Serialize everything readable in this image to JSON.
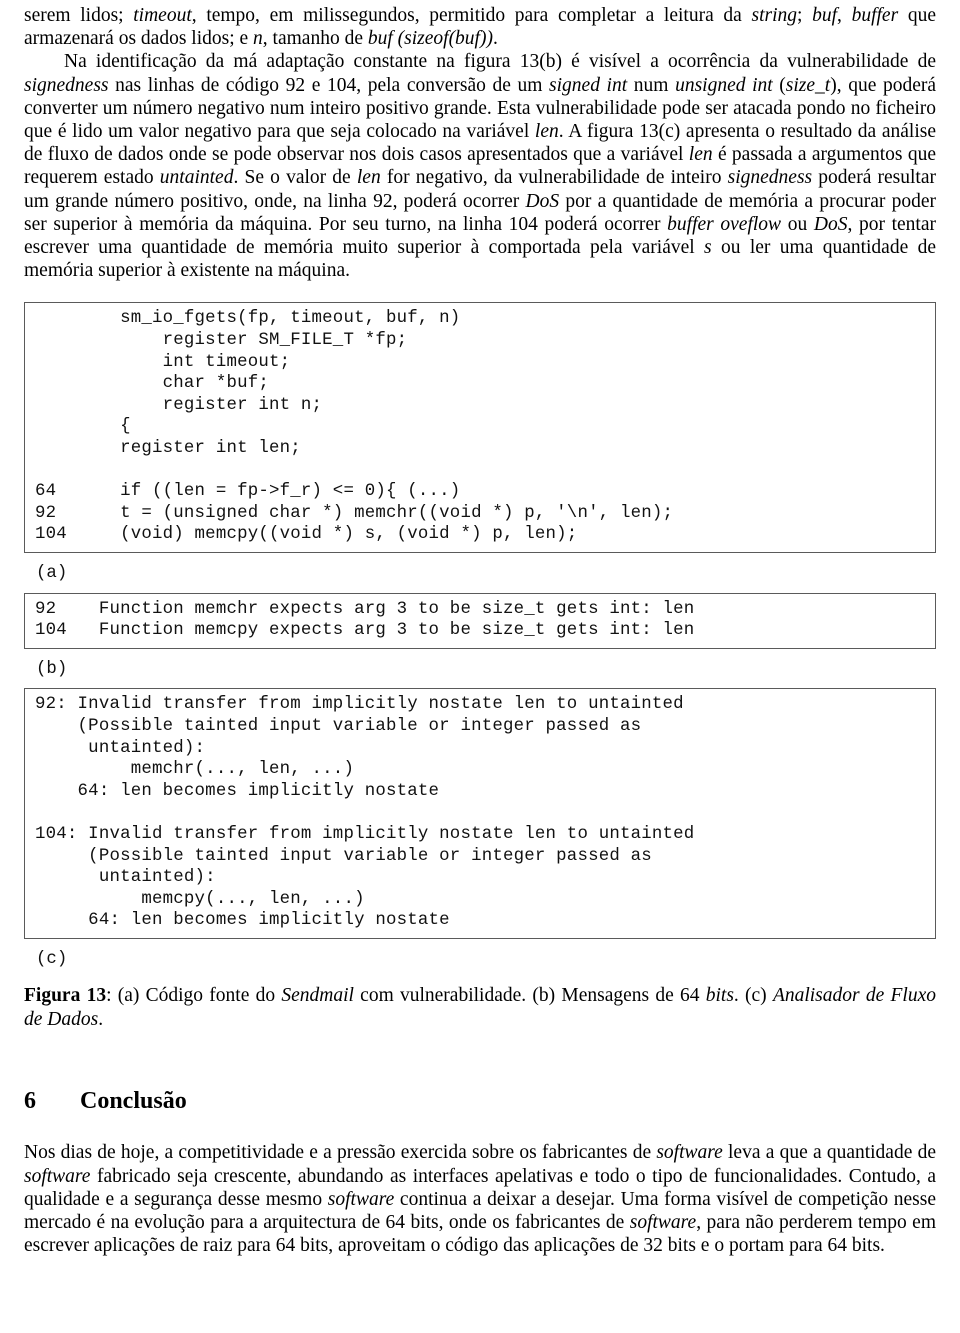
{
  "document": {
    "language": "pt-PT",
    "paragraphs": [
      {
        "id": "para-1",
        "runs": [
          {
            "t": "serem lidos; ",
            "s": "r"
          },
          {
            "t": "timeout",
            "s": "i"
          },
          {
            "t": ", tempo, em milissegundos, permitido para completar a leitura da ",
            "s": "r"
          },
          {
            "t": "string",
            "s": "i"
          },
          {
            "t": "; ",
            "s": "r"
          },
          {
            "t": "buf",
            "s": "i"
          },
          {
            "t": ", ",
            "s": "r"
          },
          {
            "t": "buffer",
            "s": "i"
          },
          {
            "t": " que armazenará os dados lidos; e ",
            "s": "r"
          },
          {
            "t": "n",
            "s": "i"
          },
          {
            "t": ", tamanho de ",
            "s": "r"
          },
          {
            "t": "buf (sizeof(buf))",
            "s": "i"
          },
          {
            "t": ".",
            "s": "r"
          }
        ]
      },
      {
        "id": "para-2",
        "indent": true,
        "runs": [
          {
            "t": "Na identificação da má adaptação constante na figura 13(b) é visível a ocorrência da vulnerabilidade de ",
            "s": "r"
          },
          {
            "t": "signedness",
            "s": "i"
          },
          {
            "t": " nas linhas de código 92 e 104, pela conversão de um ",
            "s": "r"
          },
          {
            "t": "signed int",
            "s": "i"
          },
          {
            "t": " num ",
            "s": "r"
          },
          {
            "t": "unsigned int",
            "s": "i"
          },
          {
            "t": " (",
            "s": "r"
          },
          {
            "t": "size_t",
            "s": "i"
          },
          {
            "t": "), que poderá converter um número negativo num inteiro positivo grande. Esta vulnerabilidade pode ser atacada pondo no ficheiro que é lido um valor negativo para que seja colocado na variável ",
            "s": "r"
          },
          {
            "t": "len",
            "s": "i"
          },
          {
            "t": ". A figura 13(c) apresenta o resultado da análise de fluxo de dados onde se pode observar nos dois casos apresentados que a variável ",
            "s": "r"
          },
          {
            "t": "len",
            "s": "i"
          },
          {
            "t": " é passada a argumentos que requerem estado ",
            "s": "r"
          },
          {
            "t": "untainted",
            "s": "i"
          },
          {
            "t": ". Se o valor de ",
            "s": "r"
          },
          {
            "t": "len",
            "s": "i"
          },
          {
            "t": " for negativo, da vulnerabilidade de inteiro ",
            "s": "r"
          },
          {
            "t": "signedness",
            "s": "i"
          },
          {
            "t": " poderá resultar um grande número positivo, onde, na linha 92, poderá ocorrer ",
            "s": "r"
          },
          {
            "t": "DoS",
            "s": "i"
          },
          {
            "t": " por a quantidade de memória a procurar poder ser superior à memória da máquina. Por seu turno, na linha 104 poderá ocorrer ",
            "s": "r"
          },
          {
            "t": "buffer oveflow",
            "s": "i"
          },
          {
            "t": " ou ",
            "s": "r"
          },
          {
            "t": "DoS",
            "s": "i"
          },
          {
            "t": ", por tentar escrever uma quantidade de memória muito superior à comportada pela variável ",
            "s": "r"
          },
          {
            "t": "s",
            "s": "i"
          },
          {
            "t": " ou ler uma quantidade de memória superior à existente na máquina.",
            "s": "r"
          }
        ]
      }
    ]
  },
  "figure": {
    "id": "figura-13",
    "blocks": {
      "a": {
        "label": "(a)",
        "code": "        sm_io_fgets(fp, timeout, buf, n)\n            register SM_FILE_T *fp;\n            int timeout;\n            char *buf;\n            register int n;\n        {\n        register int len;\n\n64      if ((len = fp->f_r) <= 0){ (...)\n92      t = (unsigned char *) memchr((void *) p, '\\n', len);\n104     (void) memcpy((void *) s, (void *) p, len);"
      },
      "b": {
        "label": "(b)",
        "code": "92    Function memchr expects arg 3 to be size_t gets int: len\n104   Function memcpy expects arg 3 to be size_t gets int: len"
      },
      "c": {
        "label": "(c)",
        "code": "92: Invalid transfer from implicitly nostate len to untainted\n    (Possible tainted input variable or integer passed as\n     untainted):\n         memchr(..., len, ...)\n    64: len becomes implicitly nostate\n\n104: Invalid transfer from implicitly nostate len to untainted\n     (Possible tainted input variable or integer passed as\n      untainted):\n          memcpy(..., len, ...)\n     64: len becomes implicitly nostate"
      }
    },
    "caption_runs": [
      {
        "t": "Figura 13",
        "s": "b"
      },
      {
        "t": ": (a) Código fonte do ",
        "s": "r"
      },
      {
        "t": "Sendmail",
        "s": "i"
      },
      {
        "t": " com vulnerabilidade. (b) Mensagens de 64 ",
        "s": "r"
      },
      {
        "t": "bits",
        "s": "i"
      },
      {
        "t": ". (c) ",
        "s": "r"
      },
      {
        "t": "Analisador de Fluxo de Dados",
        "s": "i"
      },
      {
        "t": ".",
        "s": "r"
      }
    ]
  },
  "section": {
    "number": "6",
    "title": "Conclusão",
    "paragraphs": [
      {
        "id": "concl-p1",
        "runs": [
          {
            "t": "Nos dias de hoje, a competitividade e a pressão exercida sobre os fabricantes de ",
            "s": "r"
          },
          {
            "t": "software",
            "s": "i"
          },
          {
            "t": " leva a que a quantidade de ",
            "s": "r"
          },
          {
            "t": "software",
            "s": "i"
          },
          {
            "t": " fabricado seja crescente, abundando as interfaces apelativas e todo o tipo de funcionalidades. Contudo, a qualidade e a segurança desse mesmo ",
            "s": "r"
          },
          {
            "t": "software",
            "s": "i"
          },
          {
            "t": " continua a deixar a desejar. Uma forma visível de competição nesse mercado é na evolução para a arquitectura de 64 bits, onde os fabricantes de ",
            "s": "r"
          },
          {
            "t": "software",
            "s": "i"
          },
          {
            "t": ", para não perderem tempo em escrever aplicações de raiz para 64 bits, aproveitam o código das aplicações de 32 bits e o portam para 64 bits.",
            "s": "r"
          }
        ]
      }
    ]
  },
  "colors": {
    "text": "#000000",
    "code_text": "#111111",
    "box_border": "#5a5a5a",
    "page_background": "#ffffff"
  }
}
